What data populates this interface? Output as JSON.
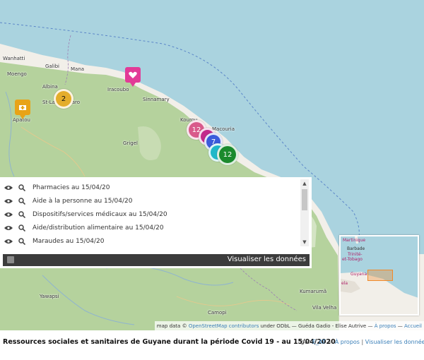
{
  "colors": {
    "sea": "#aad3df",
    "land": "#f2efe9",
    "forest": "#b5d29d",
    "cluster_yellow": "#e4ad2b",
    "cluster_pink": "#d95a8b",
    "cluster_magenta": "#c22a8c",
    "cluster_blue": "#3b5bdb",
    "cluster_cyan": "#1fb8c9",
    "cluster_green": "#1b8a2d",
    "marker_pink": "#e23b97",
    "marker_yellow": "#e8a317"
  },
  "places": [
    {
      "label": "Wanhatti",
      "color": "dark"
    },
    {
      "label": "Moengo",
      "color": "dark"
    },
    {
      "label": "Galibi",
      "color": "dark"
    },
    {
      "label": "Mana",
      "color": "dark"
    },
    {
      "label": "Albina",
      "color": "dark"
    },
    {
      "label": "St-Lau du Maro",
      "color": "dark"
    },
    {
      "label": "Apatou",
      "color": "dark"
    },
    {
      "label": "Iracoubo",
      "color": "dark"
    },
    {
      "label": "Sinnamary",
      "color": "dark"
    },
    {
      "label": "Kourou",
      "color": "dark"
    },
    {
      "label": "Macouria",
      "color": "dark"
    },
    {
      "label": "Grigel",
      "color": "dark"
    },
    {
      "label": "Kumarumã",
      "color": "dark"
    },
    {
      "label": "Vila Velha",
      "color": "dark"
    },
    {
      "label": "Yawapsi",
      "color": "dark"
    },
    {
      "label": "Camopi",
      "color": "dark"
    }
  ],
  "clusters": [
    {
      "count": "2",
      "color": "#e4ad2b"
    },
    {
      "count": "12",
      "color": "#d95a8b"
    },
    {
      "count": "",
      "color": "#c22a8c"
    },
    {
      "count": "7",
      "color": "#3b5bdb"
    },
    {
      "count": "",
      "color": "#1fb8c9"
    },
    {
      "count": "12",
      "color": "#1b8a2d"
    }
  ],
  "markers": [
    {
      "icon": "hand-heart-icon",
      "color": "#e23b97"
    },
    {
      "icon": "medical-icon",
      "color": "#e8a317"
    }
  ],
  "layers": [
    {
      "label": "Pharmacies au 15/04/20"
    },
    {
      "label": "Aide à la personne au 15/04/20"
    },
    {
      "label": "Dispositifs/services médicaux au 15/04/20"
    },
    {
      "label": "Aide/distribution alimentaire au 15/04/20"
    },
    {
      "label": "Maraudes au 15/04/20"
    }
  ],
  "viz_button": "Visualiser les données",
  "minimap": {
    "labels": [
      "Martinique",
      "Barbade",
      "Trinité-",
      "et-Tobago",
      "Guyana",
      "ela"
    ]
  },
  "attribution": {
    "prefix": "map data ©",
    "osm": "OpenStreetMap contributors",
    "rest": "under ODbL — Guéda Gadio - Elise Autrive —",
    "apropos": "À propos",
    "sep": "—",
    "accueil": "Accueil"
  },
  "footer": {
    "title": "Ressources sociales et sanitaires de Guyane durant la période Covid 19 - au 15/04/2020",
    "by": "par",
    "author": "E_AT",
    "dash": "—",
    "apropos": "À propos",
    "pipe": "|",
    "viz": "Visualiser les données"
  }
}
